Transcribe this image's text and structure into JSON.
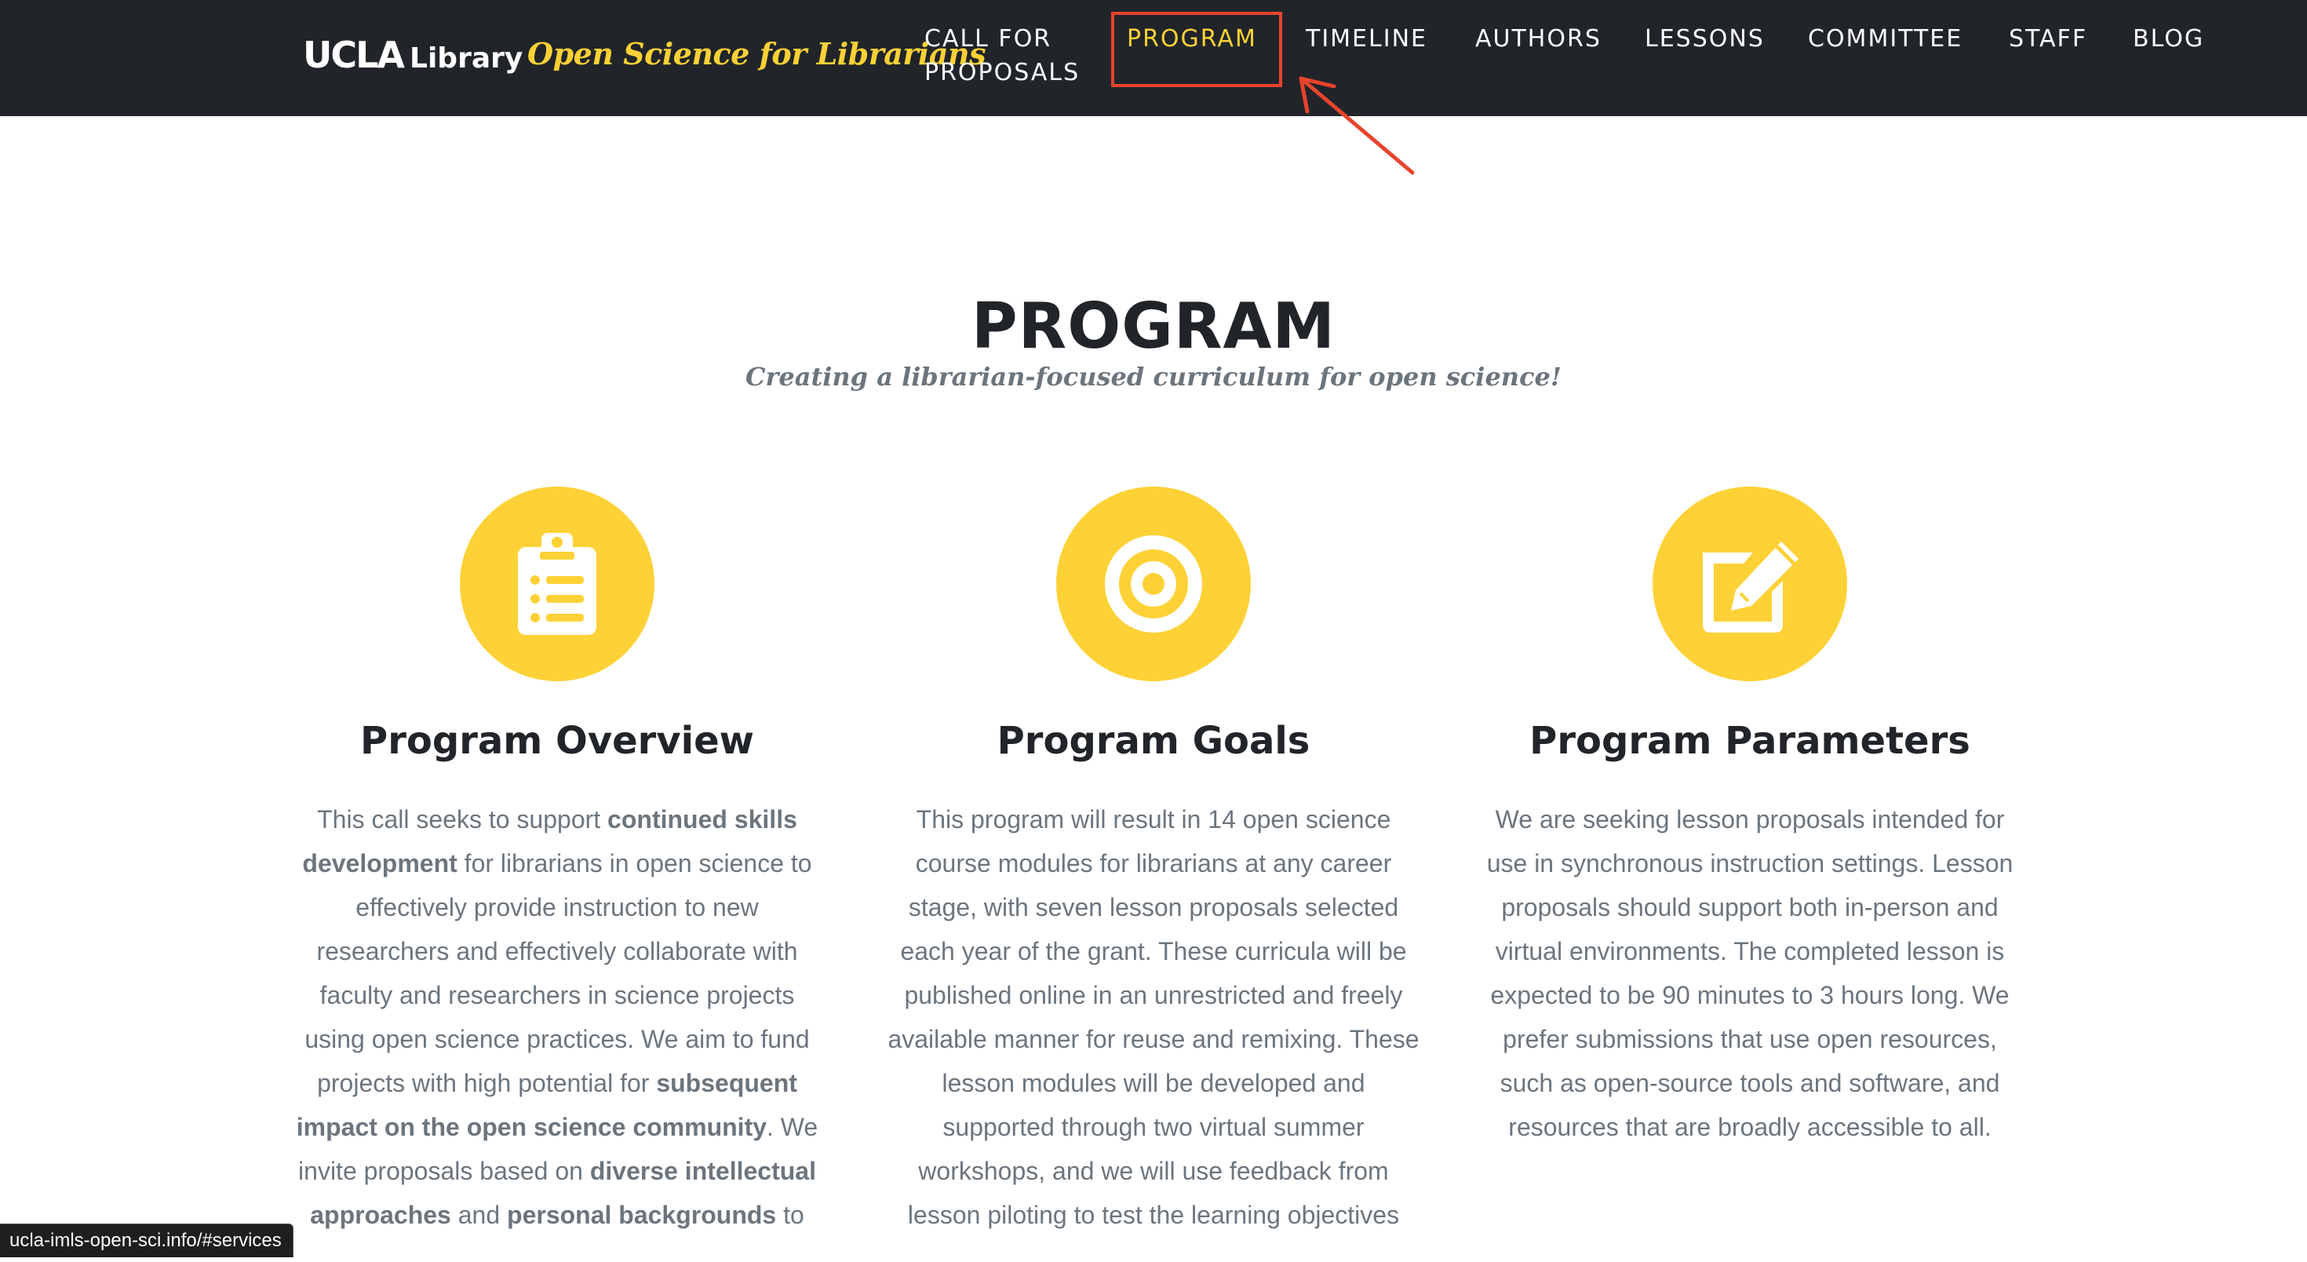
{
  "navbar": {
    "brand_ucla": "UCLA",
    "brand_library": "Library",
    "brand_tagline": "Open Science for Librarians",
    "items": [
      {
        "label": "CALL FOR PROPOSALS"
      },
      {
        "label": "PROGRAM"
      },
      {
        "label": "TIMELINE"
      },
      {
        "label": "AUTHORS"
      },
      {
        "label": "LESSONS"
      },
      {
        "label": "COMMITTEE"
      },
      {
        "label": "STAFF"
      },
      {
        "label": "BLOG"
      }
    ],
    "active_item": "PROGRAM"
  },
  "section": {
    "title": "PROGRAM",
    "subtitle": "Creating a librarian-focused curriculum for open science!"
  },
  "columns": [
    {
      "icon": "clipboard-list-icon",
      "title": "Program Overview",
      "paragraph": [
        {
          "text": "This call seeks to support ",
          "bold": false
        },
        {
          "text": "continued skills development",
          "bold": true
        },
        {
          "text": " for librarians in open science to effectively provide instruction to new researchers and effectively collaborate with faculty and researchers in science projects using open science practices. We aim to fund projects with high potential for ",
          "bold": false
        },
        {
          "text": "subsequent impact on the open science community",
          "bold": true
        },
        {
          "text": ". We invite proposals based on ",
          "bold": false
        },
        {
          "text": "diverse intellectual approaches",
          "bold": true
        },
        {
          "text": " and ",
          "bold": false
        },
        {
          "text": "personal backgrounds",
          "bold": true
        },
        {
          "text": " to",
          "bold": false
        }
      ]
    },
    {
      "icon": "bullseye-icon",
      "title": "Program Goals",
      "paragraph": [
        {
          "text": "This program will result in 14 open science course modules for librarians at any career stage, with seven lesson proposals selected each year of the grant. These curricula will be published online in an unrestricted and freely available manner for reuse and remixing. These lesson modules will be developed and supported through two virtual summer workshops, and we will use feedback from lesson piloting to test the learning objectives",
          "bold": false
        }
      ]
    },
    {
      "icon": "edit-icon",
      "title": "Program Parameters",
      "paragraph": [
        {
          "text": "We are seeking lesson proposals intended for use in synchronous instruction settings. Lesson proposals should support both in-person and virtual environments. The completed lesson is expected to be 90 minutes to 3 hours long. We prefer submissions that use open resources, such as open-source tools and software, and resources that are broadly accessible to all.",
          "bold": false
        }
      ]
    }
  ],
  "status_bar": {
    "url": "ucla-imls-open-sci.info/#services"
  },
  "colors": {
    "navbar_bg": "#212529",
    "accent_yellow": "#fed136",
    "annotation_red": "#e8432e",
    "body_text": "#6c757d",
    "heading_text": "#212529"
  }
}
